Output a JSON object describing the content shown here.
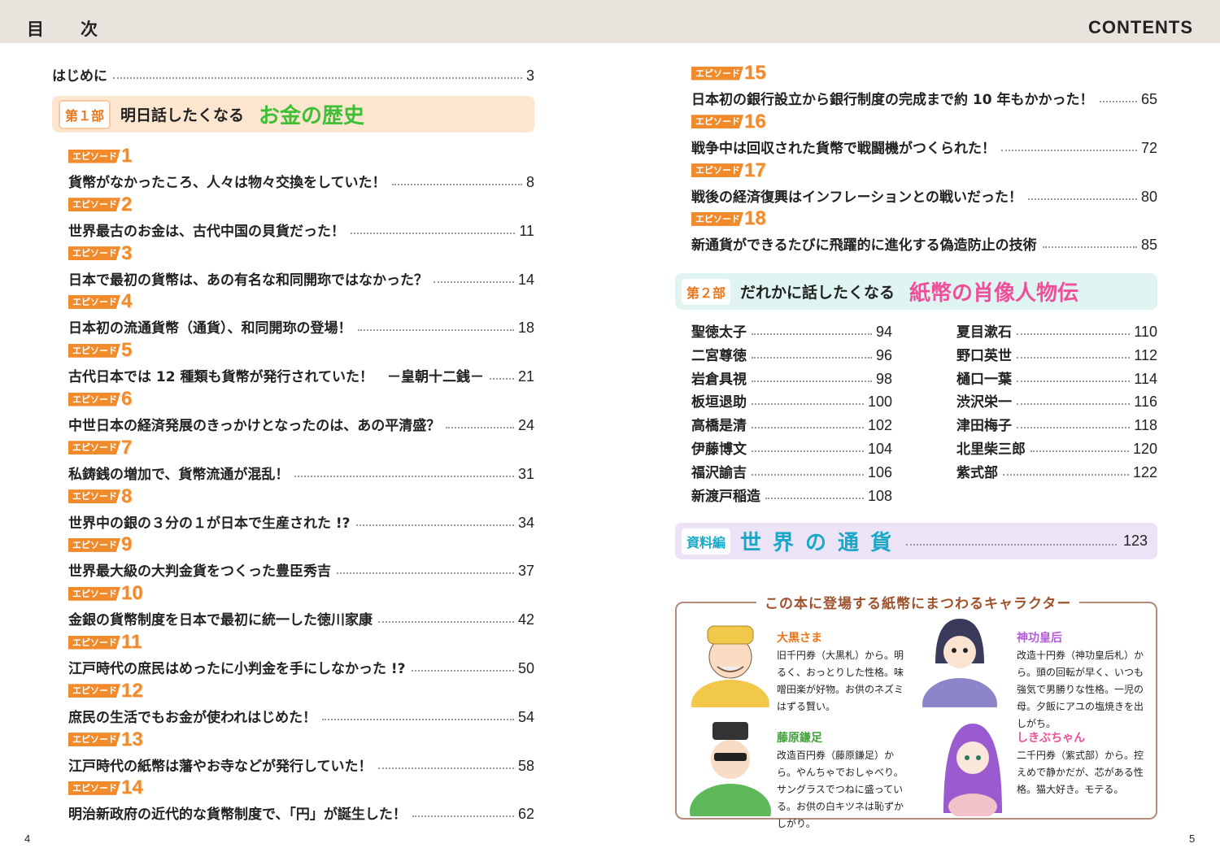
{
  "header": {
    "left_title": "目　次",
    "right_title": "CONTENTS"
  },
  "page_numbers": {
    "left": "4",
    "right": "5"
  },
  "intro": {
    "label": "はじめに",
    "page": "3"
  },
  "part1": {
    "tag": "第１部",
    "subtitle": "明日話したくなる",
    "title": "お金の歴史"
  },
  "episode_label": "エピソード",
  "episodes": [
    {
      "num": "1",
      "title": "貨幣がなかったころ、人々は物々交換をしていた！",
      "page": "8"
    },
    {
      "num": "2",
      "title": "世界最古のお金は、古代中国の貝貨だった！",
      "page": "11"
    },
    {
      "num": "3",
      "title": "日本で最初の貨幣は、あの有名な和同開珎ではなかった？",
      "page": "14"
    },
    {
      "num": "4",
      "title": "日本初の流通貨幣（通貨）、和同開珎の登場！",
      "page": "18"
    },
    {
      "num": "5",
      "title": "古代日本では 12 種類も貨幣が発行されていた！　－皇朝十二銭－",
      "page": "21"
    },
    {
      "num": "6",
      "title": "中世日本の経済発展のきっかけとなったのは、あの平清盛？",
      "page": "24"
    },
    {
      "num": "7",
      "title": "私鋳銭の増加で、貨幣流通が混乱！",
      "page": "31"
    },
    {
      "num": "8",
      "title": "世界中の銀の３分の１が日本で生産された !?",
      "page": "34"
    },
    {
      "num": "9",
      "title": "世界最大級の大判金貨をつくった豊臣秀吉",
      "page": "37"
    },
    {
      "num": "10",
      "title": "金銀の貨幣制度を日本で最初に統一した徳川家康",
      "page": "42"
    },
    {
      "num": "11",
      "title": "江戸時代の庶民はめったに小判金を手にしなかった !?",
      "page": "50"
    },
    {
      "num": "12",
      "title": "庶民の生活でもお金が使われはじめた！",
      "page": "54"
    },
    {
      "num": "13",
      "title": "江戸時代の紙幣は藩やお寺などが発行していた！",
      "page": "58"
    },
    {
      "num": "14",
      "title": "明治新政府の近代的な貨幣制度で、「円」が誕生した！",
      "page": "62"
    },
    {
      "num": "15",
      "title": "日本初の銀行設立から銀行制度の完成まで約 10 年もかかった！",
      "page": "65"
    },
    {
      "num": "16",
      "title": "戦争中は回収された貨幣で戦闘機がつくられた！",
      "page": "72"
    },
    {
      "num": "17",
      "title": "戦後の経済復興はインフレーションとの戦いだった！",
      "page": "80"
    },
    {
      "num": "18",
      "title": "新通貨ができるたびに飛躍的に進化する偽造防止の技術",
      "page": "85"
    }
  ],
  "part2": {
    "tag": "第２部",
    "subtitle": "だれかに話したくなる",
    "title": "紙幣の肖像人物伝"
  },
  "people_left": [
    {
      "name": "聖徳太子",
      "page": "94"
    },
    {
      "name": "二宮尊徳",
      "page": "96"
    },
    {
      "name": "岩倉具視",
      "page": "98"
    },
    {
      "name": "板垣退助",
      "page": "100"
    },
    {
      "name": "高橋是清",
      "page": "102"
    },
    {
      "name": "伊藤博文",
      "page": "104"
    },
    {
      "name": "福沢諭吉",
      "page": "106"
    },
    {
      "name": "新渡戸稲造",
      "page": "108"
    }
  ],
  "people_right": [
    {
      "name": "夏目漱石",
      "page": "110"
    },
    {
      "name": "野口英世",
      "page": "112"
    },
    {
      "name": "樋口一葉",
      "page": "114"
    },
    {
      "name": "渋沢栄一",
      "page": "116"
    },
    {
      "name": "津田梅子",
      "page": "118"
    },
    {
      "name": "北里柴三郎",
      "page": "120"
    },
    {
      "name": "紫式部",
      "page": "122"
    }
  ],
  "part3": {
    "tag": "資料編",
    "title": "世界の通貨",
    "page": "123"
  },
  "characters": {
    "title": "この本に登場する紙幣にまつわるキャラクター",
    "items": [
      {
        "name": "大黒さま",
        "desc": "旧千円券（大黒札）から。明るく、おっとりした性格。味噌田楽が好物。お供のネズミはずる賢い。"
      },
      {
        "name": "神功皇后",
        "desc": "改造十円券（神功皇后札）から。頭の回転が早く、いつも強気で男勝りな性格。一児の母。夕飯にアユの塩焼きを出しがち。"
      },
      {
        "name": "藤原鎌足",
        "desc": "改造百円券（藤原鎌足）から。やんちゃでおしゃべり。サングラスでつねに盛っている。お供の白キツネは恥ずかしがり。"
      },
      {
        "name": "しきぶちゃん",
        "desc": "二千円券（紫式部）から。控えめで静かだが、芯がある性格。猫大好き。モテる。"
      }
    ]
  },
  "colors": {
    "accent_orange": "#f08a2a",
    "green_title": "#3fbf35",
    "pink_title": "#ef4f9a",
    "cyan_title": "#1aa7c8"
  }
}
